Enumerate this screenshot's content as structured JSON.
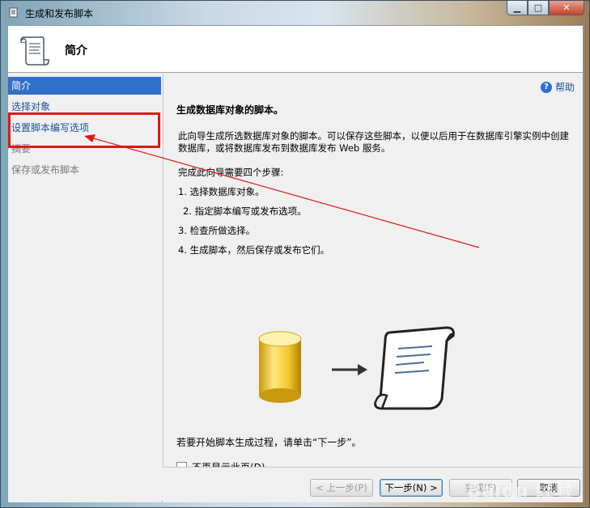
{
  "window": {
    "title": "生成和发布脚本",
    "controls": {
      "minimize": "▁",
      "maximize": "□",
      "close": "✕"
    }
  },
  "header": {
    "title": "简介"
  },
  "nav": {
    "items": [
      {
        "label": "简介",
        "state": "selected"
      },
      {
        "label": "选择对象",
        "state": "link"
      },
      {
        "label": "设置脚本编写选项",
        "state": "link"
      },
      {
        "label": "摘要",
        "state": "disabled"
      },
      {
        "label": "保存或发布脚本",
        "state": "disabled"
      }
    ]
  },
  "content": {
    "help_label": "帮助",
    "help_icon": "?",
    "title": "生成数据库对象的脚本。",
    "description": "此向导生成所选数据库对象的脚本。可以保存这些脚本，以便以后用于在数据库引擎实例中创建数据库，或将数据库发布到数据库发布 Web 服务。",
    "steps_heading": "完成此向导需要四个步骤:",
    "steps": [
      "1.  选择数据库对象。",
      "2.  指定脚本编写或发布选项。",
      "3.  检查所做选择。",
      "4.  生成脚本，然后保存或发布它们。"
    ],
    "start_text": "若要开始脚本生成过程，请单击“下一步”。",
    "checkbox_label": "不再显示此页(D)。",
    "checkbox_checked": false
  },
  "footer": {
    "prev": "< 上一步(P)",
    "next": "下一步(N) >",
    "finish": "完成(F)",
    "cancel": "取消"
  },
  "watermark": "Baidu 经验",
  "colors": {
    "selection": "#3070c8",
    "link": "#1f4f9c",
    "annotation": "#e01818"
  }
}
